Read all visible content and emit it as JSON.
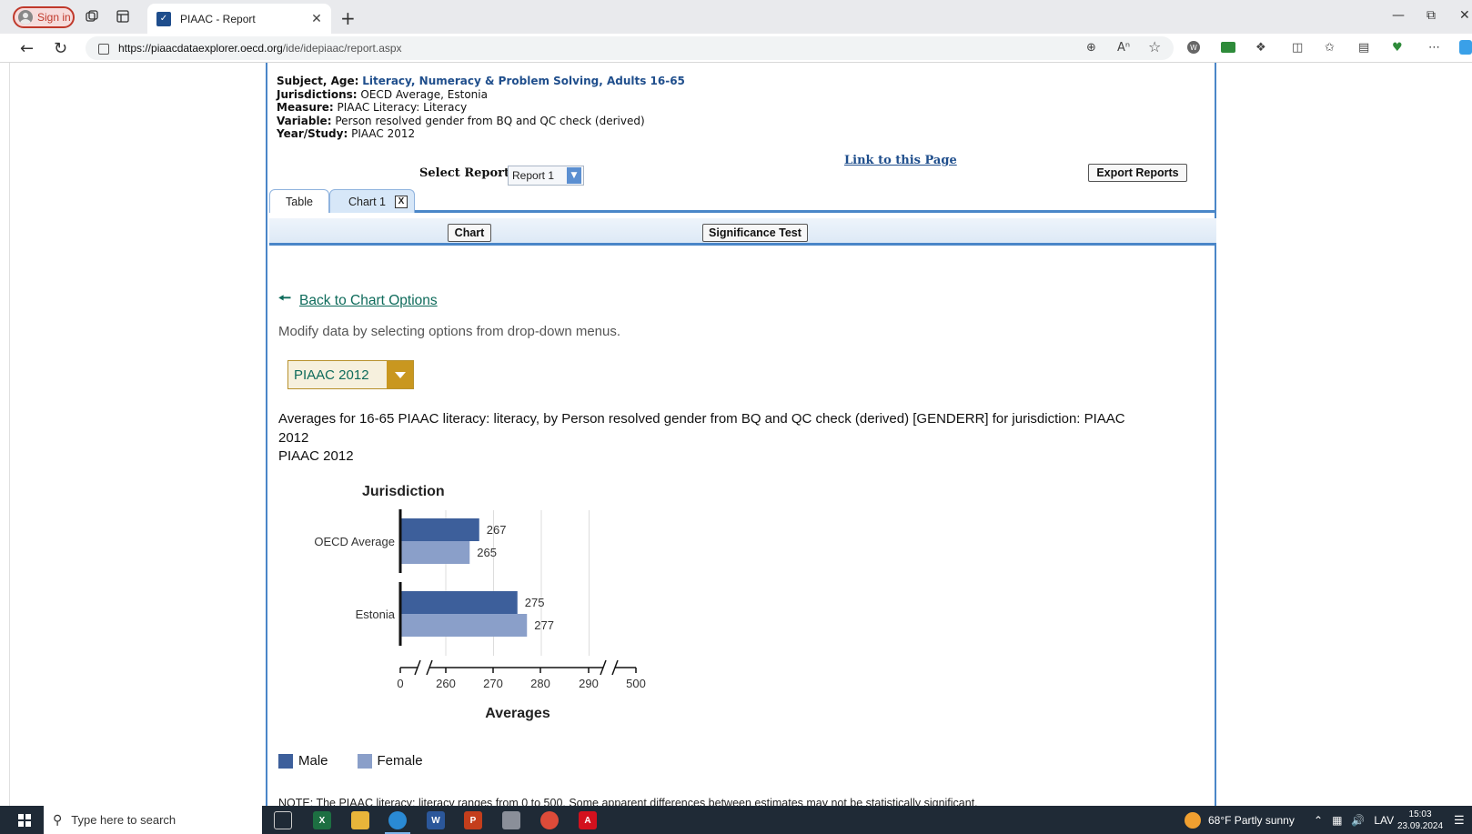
{
  "browser": {
    "signin_label": "Sign in",
    "tab_title": "PIAAC - Report",
    "url_host": "https://piaacdataexplorer.oecd.org",
    "url_path": "/ide/idepiaac/report.aspx",
    "icons": [
      "profile-icon",
      "workspaces-icon",
      "tab-actions-icon",
      "close-tab-icon",
      "new-tab-icon",
      "back-icon",
      "refresh-icon",
      "lock-icon",
      "zoom-icon",
      "read-aloud-icon",
      "favorite-icon",
      "extension-icon",
      "print-icon",
      "puzzle-icon",
      "split-screen-icon",
      "favorites-icon",
      "collections-icon",
      "browser-essentials-icon",
      "more-icon",
      "copilot-icon"
    ]
  },
  "report": {
    "subject_label": "Subject, Age:",
    "subject_value": "Literacy, Numeracy & Problem Solving, Adults 16-65",
    "jurisdictions_label": "Jurisdictions:",
    "jurisdictions_value": "OECD Average, Estonia",
    "measure_label": "Measure:",
    "measure_value": "PIAAC Literacy: Literacy",
    "variable_label": "Variable:",
    "variable_value": "Person resolved gender from BQ and QC check (derived)",
    "year_label": "Year/Study:",
    "year_value": "PIAAC 2012",
    "link_label": "Link to this Page",
    "select_report_label": "Select Report:",
    "select_report_value": "Report 1",
    "export_label": "Export Reports",
    "tabs": [
      {
        "label": "Table"
      },
      {
        "label": "Chart 1",
        "close": "X"
      }
    ],
    "chart_button": "Chart",
    "significance_button": "Significance Test",
    "back_link": "Back to Chart Options",
    "modify_text": "Modify data by selecting options from drop-down menus.",
    "year_select_value": "PIAAC 2012",
    "caption": "Averages for 16-65 PIAAC literacy: literacy, by Person resolved gender from BQ and QC check (derived) [GENDERR] for jurisdiction: PIAAC 2012",
    "caption_sub": "PIAAC 2012",
    "note": "NOTE: The PIAAC literacy: literacy ranges from 0 to 500. Some apparent differences between estimates may not be statistically significant."
  },
  "chart_data": {
    "type": "bar",
    "orientation": "horizontal",
    "ylabel": "Jurisdiction",
    "xlabel": "Averages",
    "categories": [
      "OECD Average",
      "Estonia"
    ],
    "series": [
      {
        "name": "Male",
        "values": [
          267,
          275
        ],
        "color": "#3d5f9b"
      },
      {
        "name": "Female",
        "values": [
          265,
          277
        ],
        "color": "#8a9fc9"
      }
    ],
    "x_ticks": [
      "0",
      "260",
      "270",
      "280",
      "290",
      "500"
    ],
    "axis_break": [
      0,
      260,
      290,
      500
    ],
    "xlim": [
      255,
      295
    ],
    "grid": true,
    "legend_position": "bottom-left"
  },
  "taskbar": {
    "search_placeholder": "Type here to search",
    "weather": "68°F  Partly sunny",
    "language": "LAV",
    "time": "15:03",
    "date": "23.09.2024",
    "apps": [
      "task-view-icon",
      "excel-icon",
      "file-explorer-icon",
      "edge-icon",
      "word-icon",
      "powerpoint-icon",
      "app-icon",
      "chrome-icon",
      "acrobat-icon"
    ]
  }
}
